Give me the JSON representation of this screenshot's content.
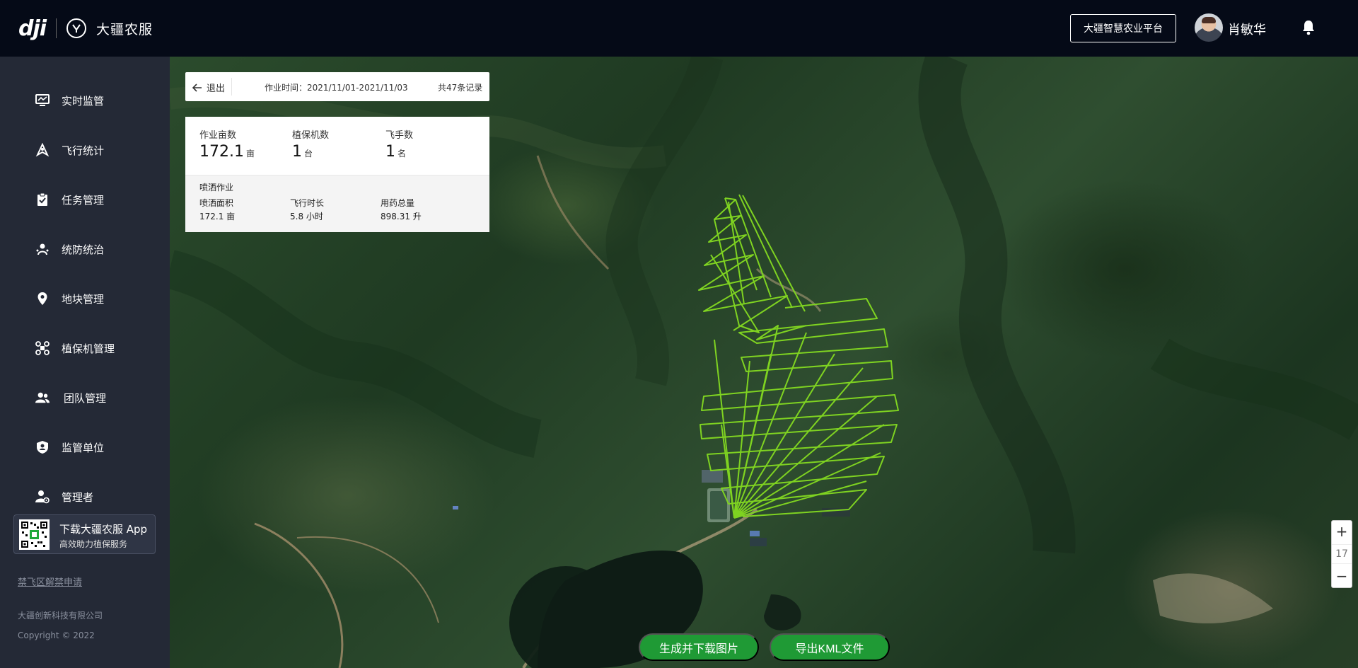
{
  "header": {
    "logo_text": "dji",
    "brand_icon_text": "㉑",
    "brand_name": "大疆农服",
    "platform_button": "大疆智慧农业平台",
    "user_name": "肖敏华"
  },
  "sidebar": {
    "items": [
      {
        "label": "实时监管",
        "icon": "monitor-icon"
      },
      {
        "label": "飞行统计",
        "icon": "flight-stats-icon"
      },
      {
        "label": "任务管理",
        "icon": "clipboard-icon"
      },
      {
        "label": "统防统治",
        "icon": "pest-control-icon"
      },
      {
        "label": "地块管理",
        "icon": "location-pin-icon"
      },
      {
        "label": "植保机管理",
        "icon": "drone-icon"
      },
      {
        "label": "团队管理",
        "icon": "team-icon"
      },
      {
        "label": "监管单位",
        "icon": "shield-icon"
      },
      {
        "label": "管理者",
        "icon": "admin-icon"
      }
    ],
    "app_card": {
      "title": "下载大疆农服 App",
      "subtitle": "高效助力植保服务"
    },
    "nofly_link": "禁飞区解禁申请",
    "company": "大疆创新科技有限公司",
    "copyright": "Copyright © 2022"
  },
  "info": {
    "exit_label": "退出",
    "work_time": "作业时间：2021/11/01-2021/11/03",
    "records": "共47条记录"
  },
  "stats": {
    "area": {
      "label": "作业亩数",
      "value": "172.1",
      "unit": "亩"
    },
    "drones": {
      "label": "植保机数",
      "value": "1",
      "unit": "台"
    },
    "pilots": {
      "label": "飞手数",
      "value": "1",
      "unit": "名"
    }
  },
  "spray": {
    "title": "喷洒作业",
    "area_label": "喷洒面积",
    "area_value": "172.1 亩",
    "duration_label": "飞行时长",
    "duration_value": "5.8 小时",
    "pesticide_label": "用药总量",
    "pesticide_value": "898.31 升"
  },
  "map": {
    "zoom_level": "17",
    "zoom_in": "+",
    "zoom_out": "−",
    "route_color": "#7fd321"
  },
  "actions": {
    "download_image": "生成并下载图片",
    "export_kml": "导出KML文件"
  }
}
